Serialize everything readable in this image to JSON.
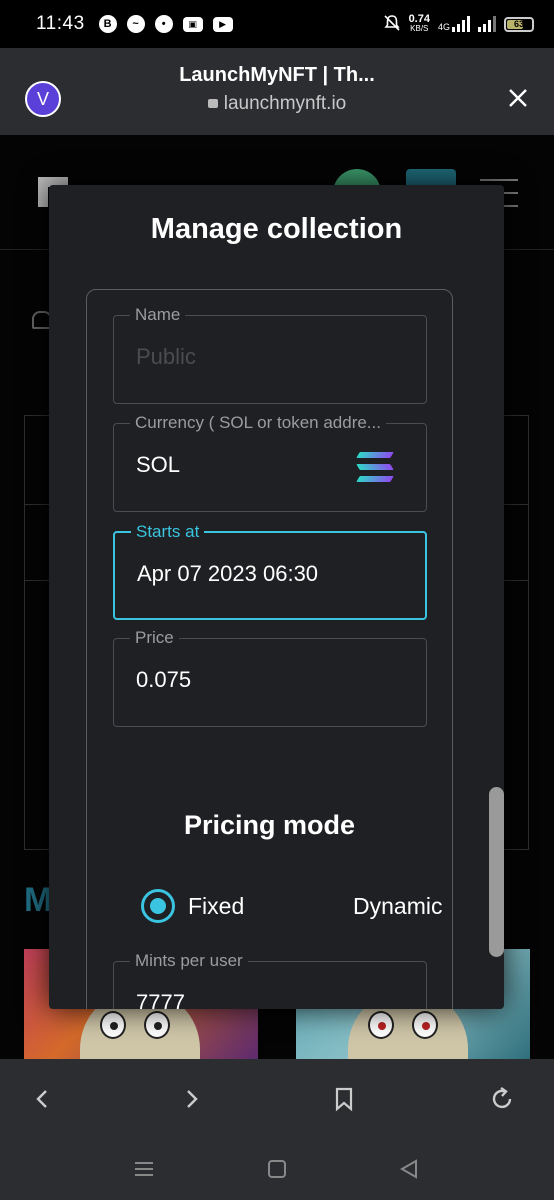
{
  "status_bar": {
    "time": "11:43",
    "network_speed": "0.74",
    "network_speed_unit": "KB/S",
    "network_type": "4G",
    "battery": "63"
  },
  "browser": {
    "site_initial": "V",
    "page_title": "LaunchMyNFT | Th...",
    "url": "launchmynft.io"
  },
  "background_page": {
    "section_letter": "M"
  },
  "modal": {
    "title": "Manage collection",
    "fields": {
      "name": {
        "label": "Name",
        "placeholder": "Public",
        "value": ""
      },
      "currency": {
        "label": "Currency ( SOL or token addre...",
        "value": "SOL",
        "icon": "solana-icon"
      },
      "starts_at": {
        "label": "Starts at",
        "value": "Apr 07 2023 06:30"
      },
      "price": {
        "label": "Price",
        "value": "0.075"
      },
      "mints_per_user": {
        "label": "Mints per user",
        "value": "7777"
      }
    },
    "pricing_mode": {
      "title": "Pricing mode",
      "options": [
        "Fixed",
        "Dynamic"
      ],
      "selected": "Fixed"
    }
  },
  "colors": {
    "accent": "#3ac4e0",
    "modal_bg": "#1f2023",
    "browser_chrome": "#2b2d31"
  }
}
